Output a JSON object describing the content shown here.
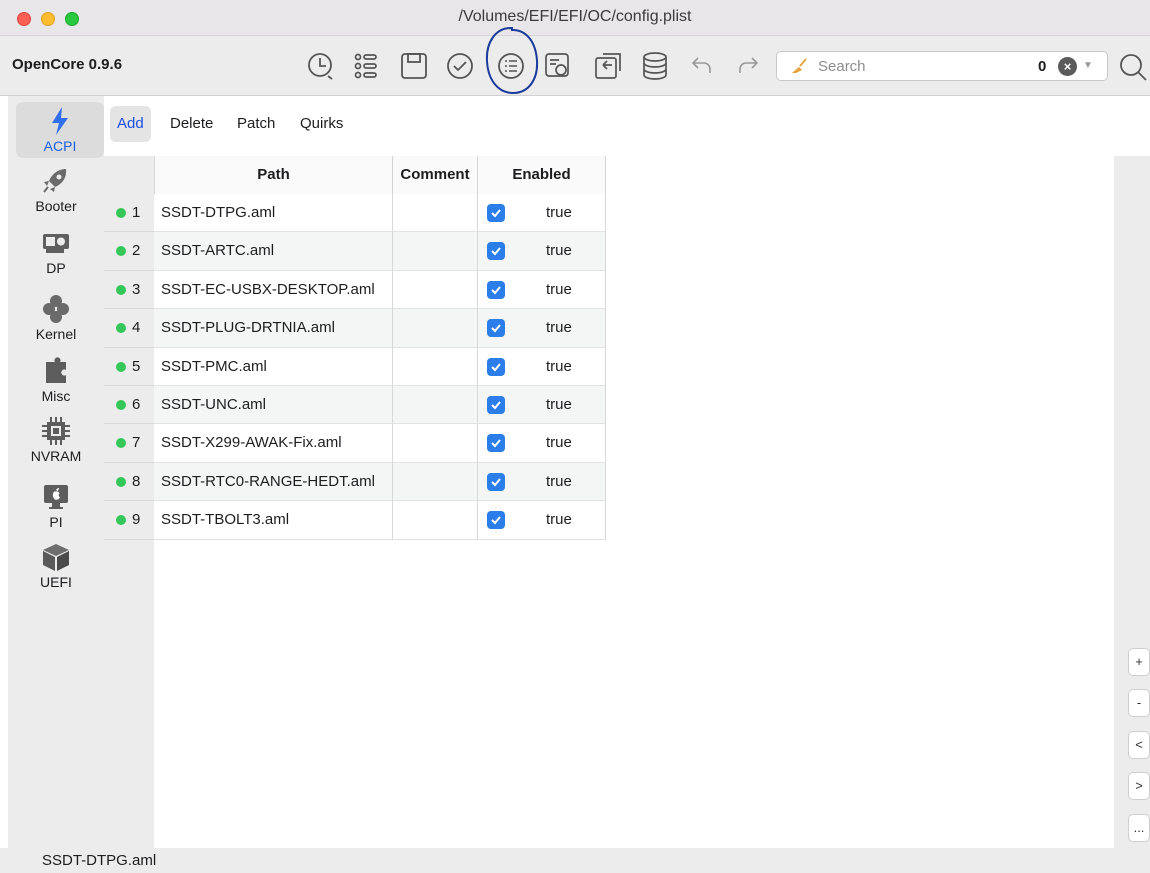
{
  "window": {
    "title": "/Volumes/EFI/EFI/OC/config.plist"
  },
  "toolbar": {
    "app_name": "OpenCore 0.9.6",
    "icons": [
      "history-icon",
      "list-icon",
      "save-icon",
      "check-icon",
      "list-circle-icon",
      "settings-file-icon",
      "import-icon",
      "database-icon",
      "undo-icon",
      "redo-icon"
    ],
    "search": {
      "placeholder": "Search",
      "count": "0"
    }
  },
  "sidebar": {
    "items": [
      {
        "label": "ACPI",
        "icon": "lightning-icon",
        "active": true
      },
      {
        "label": "Booter",
        "icon": "rocket-icon"
      },
      {
        "label": "DP",
        "icon": "gpu-card-icon"
      },
      {
        "label": "Kernel",
        "icon": "gears-icon"
      },
      {
        "label": "Misc",
        "icon": "puzzle-icon"
      },
      {
        "label": "NVRAM",
        "icon": "chip-icon"
      },
      {
        "label": "PI",
        "icon": "mac-icon"
      },
      {
        "label": "UEFI",
        "icon": "cube-icon"
      }
    ]
  },
  "tabs": [
    {
      "label": "Add",
      "active": true
    },
    {
      "label": "Delete"
    },
    {
      "label": "Patch"
    },
    {
      "label": "Quirks"
    }
  ],
  "table": {
    "headers": {
      "path": "Path",
      "comment": "Comment",
      "enabled": "Enabled"
    },
    "rows": [
      {
        "n": "1",
        "path": "SSDT-DTPG.aml",
        "comment": "",
        "enabled": "true"
      },
      {
        "n": "2",
        "path": "SSDT-ARTC.aml",
        "comment": "",
        "enabled": "true"
      },
      {
        "n": "3",
        "path": "SSDT-EC-USBX-DESKTOP.aml",
        "comment": "",
        "enabled": "true"
      },
      {
        "n": "4",
        "path": "SSDT-PLUG-DRTNIA.aml",
        "comment": "",
        "enabled": "true"
      },
      {
        "n": "5",
        "path": "SSDT-PMC.aml",
        "comment": "",
        "enabled": "true"
      },
      {
        "n": "6",
        "path": "SSDT-UNC.aml",
        "comment": "",
        "enabled": "true"
      },
      {
        "n": "7",
        "path": "SSDT-X299-AWAK-Fix.aml",
        "comment": "",
        "enabled": "true"
      },
      {
        "n": "8",
        "path": "SSDT-RTC0-RANGE-HEDT.aml",
        "comment": "",
        "enabled": "true"
      },
      {
        "n": "9",
        "path": "SSDT-TBOLT3.aml",
        "comment": "",
        "enabled": "true"
      }
    ]
  },
  "side_buttons": {
    "add": "+",
    "remove": "-",
    "prev": "<",
    "next": ">",
    "more": "..."
  },
  "status": {
    "text": "SSDT-DTPG.aml"
  },
  "colors": {
    "accent": "#1a4de0",
    "checkbox": "#2b7de9",
    "dot": "#34c759",
    "annotation": "#1a3a9c"
  }
}
